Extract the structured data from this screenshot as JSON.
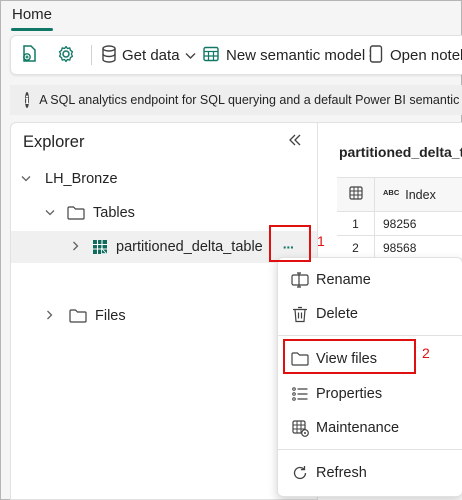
{
  "ribbon": {
    "active_tab": "Home"
  },
  "toolbar": {
    "get_data_label": "Get data",
    "new_model_label": "New semantic model",
    "notebook_label": "Open notebo"
  },
  "infobar": {
    "text": "A SQL analytics endpoint for SQL querying and a default Power BI semantic m"
  },
  "explorer": {
    "title": "Explorer",
    "lakehouse": "LH_Bronze",
    "tables_folder": "Tables",
    "table_name": "partitioned_delta_table",
    "more_label": "···",
    "files_folder": "Files"
  },
  "preview": {
    "title": "partitioned_delta_ta",
    "type_badge": "ABC",
    "column_header": "Index",
    "rows": [
      {
        "num": "1",
        "index": "98256"
      },
      {
        "num": "2",
        "index": "98568"
      }
    ]
  },
  "context_menu": {
    "items": [
      "Rename",
      "Delete",
      "View files",
      "Properties",
      "Maintenance",
      "Refresh"
    ]
  },
  "annotations": {
    "step1": "1",
    "step2": "2"
  },
  "colors": {
    "accent": "#117865",
    "annotation": "#e01010"
  }
}
